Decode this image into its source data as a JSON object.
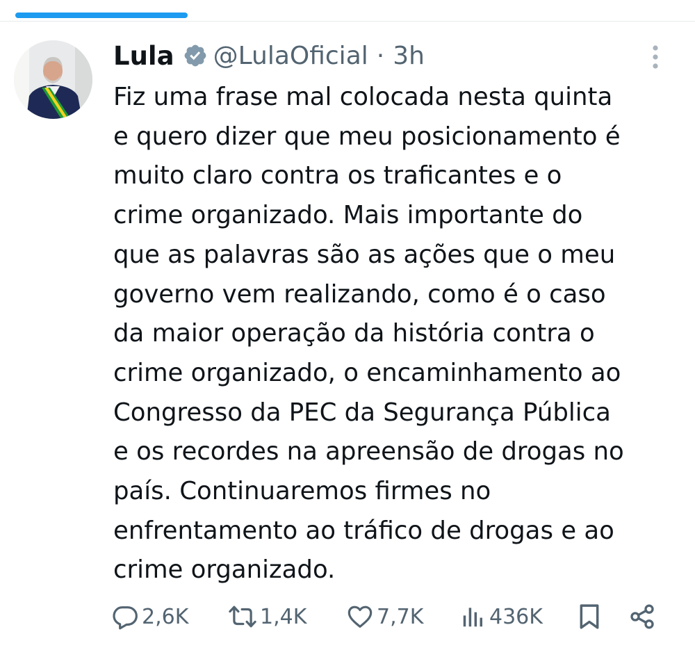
{
  "post": {
    "author_name": "Lula",
    "handle": "@LulaOficial",
    "separator": "·",
    "time": "3h",
    "text": "Fiz uma frase mal colocada nesta quinta\ne quero dizer que meu posicionamento é\nmuito claro contra os traficantes e o\ncrime organizado. Mais importante do\nque as palavras são as ações que o meu\ngoverno vem realizando, como é o caso\nda maior operação da história contra o\ncrime organizado, o encaminhamento ao\nCongresso da PEC da Segurança Pública\ne os recordes na apreensão de drogas no\npaís. Continuaremos firmes no\nenfrentamento ao tráfico de drogas e ao\ncrime organizado."
  },
  "actions": {
    "replies": "2,6K",
    "reposts": "1,4K",
    "likes": "7,7K",
    "views": "436K"
  },
  "icons": {
    "verified": "verified-badge-icon",
    "more": "more-vertical-icon",
    "reply": "reply-icon",
    "repost": "repost-icon",
    "like": "heart-icon",
    "views": "views-icon",
    "bookmark": "bookmark-icon",
    "share": "share-icon"
  },
  "colors": {
    "accent": "#1d9bf0",
    "text": "#0f1419",
    "secondary": "#536471",
    "badge": "#829aab"
  }
}
